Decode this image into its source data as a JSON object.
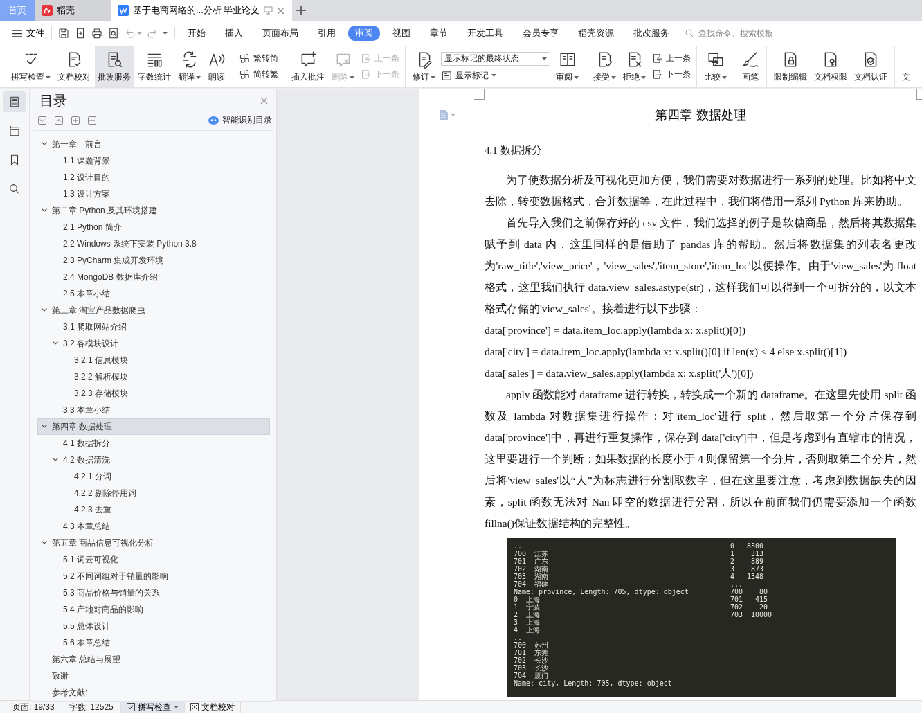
{
  "title_tabs": [
    {
      "kind": "home",
      "label": "首页",
      "selected": false
    },
    {
      "kind": "docer",
      "label": "稻壳",
      "selected": false
    },
    {
      "kind": "document",
      "label": "基于电商网络的...分析 毕业论文",
      "selected": true
    }
  ],
  "menu": {
    "file": "文件",
    "tabs": [
      {
        "label": "开始",
        "selected": false
      },
      {
        "label": "插入",
        "selected": false
      },
      {
        "label": "页面布局",
        "selected": false
      },
      {
        "label": "引用",
        "selected": false
      },
      {
        "label": "审阅",
        "selected": true
      },
      {
        "label": "视图",
        "selected": false
      },
      {
        "label": "章节",
        "selected": false
      },
      {
        "label": "开发工具",
        "selected": false
      },
      {
        "label": "会员专享",
        "selected": false
      },
      {
        "label": "稻壳资源",
        "selected": false
      },
      {
        "label": "批改服务",
        "selected": false
      }
    ],
    "search": {
      "placeholder": "查找命令、搜索模板"
    }
  },
  "ribbon": {
    "groups": [
      {
        "items": [
          {
            "kind": "large",
            "label": "拼写检查",
            "caret": true,
            "selected": false
          },
          {
            "kind": "large",
            "label": "文档校对",
            "selected": false
          },
          {
            "kind": "large",
            "label": "批改服务",
            "selected": true
          },
          {
            "kind": "large",
            "label": "字数统计",
            "selected": false
          },
          {
            "kind": "large",
            "label": "翻译",
            "caret": true,
            "selected": false
          },
          {
            "kind": "large",
            "label": "朗读",
            "selected": false
          }
        ]
      },
      {
        "items": [
          {
            "kind": "stack",
            "items": [
              {
                "kind": "small",
                "label": "繁转简",
                "disabled": false
              },
              {
                "kind": "small",
                "label": "简转繁",
                "disabled": false
              }
            ]
          }
        ]
      },
      {
        "items": [
          {
            "kind": "large",
            "label": "插入批注",
            "selected": false
          },
          {
            "kind": "large",
            "label": "删除",
            "caret": true,
            "disabled": true,
            "selected": false
          },
          {
            "kind": "stack",
            "items": [
              {
                "kind": "small",
                "label": "上一条",
                "disabled": true
              },
              {
                "kind": "small",
                "label": "下一条",
                "disabled": true
              }
            ]
          }
        ]
      },
      {
        "items": [
          {
            "kind": "large",
            "label": "修订",
            "caret": true,
            "selected": false
          },
          {
            "kind": "stack",
            "items": [
              {
                "kind": "select",
                "value": "显示标记的最终状态"
              },
              {
                "kind": "small",
                "label": "显示标记",
                "caret": true,
                "disabled": false
              }
            ]
          },
          {
            "kind": "large",
            "label": "审阅",
            "caret": true,
            "selected": false
          }
        ]
      },
      {
        "items": [
          {
            "kind": "large",
            "label": "接受",
            "caret": true,
            "selected": false
          },
          {
            "kind": "large",
            "label": "拒绝",
            "caret": true,
            "selected": false
          },
          {
            "kind": "stack",
            "items": [
              {
                "kind": "small",
                "label": "上一条",
                "disabled": false
              },
              {
                "kind": "small",
                "label": "下一条",
                "disabled": false
              }
            ]
          }
        ]
      },
      {
        "items": [
          {
            "kind": "large",
            "label": "比较",
            "caret": true,
            "selected": false
          }
        ]
      },
      {
        "items": [
          {
            "kind": "large",
            "label": "画笔",
            "selected": false
          }
        ]
      },
      {
        "items": [
          {
            "kind": "large",
            "label": "限制编辑",
            "selected": false
          },
          {
            "kind": "large",
            "label": "文档权限",
            "selected": false
          },
          {
            "kind": "large",
            "label": "文档认证",
            "selected": false
          }
        ]
      },
      {
        "items": [
          {
            "kind": "large",
            "label": "文",
            "selected": false
          }
        ]
      }
    ]
  },
  "sidebar": {
    "tools": [
      {
        "selected": true
      },
      {
        "selected": false
      },
      {
        "selected": false
      },
      {
        "selected": false
      }
    ]
  },
  "toc": {
    "title": "目录",
    "smart_link": "智能识别目录",
    "items": [
      {
        "label": "第一章　前言",
        "expanded": true,
        "selected": false,
        "children": [
          {
            "label": "1.1 课题背景",
            "selected": false
          },
          {
            "label": "1.2 设计目的",
            "selected": false
          },
          {
            "label": "1.3 设计方案",
            "selected": false
          }
        ]
      },
      {
        "label": "第二章  Python 及其环境搭建",
        "expanded": true,
        "selected": false,
        "children": [
          {
            "label": "2.1 Python 简介",
            "selected": false
          },
          {
            "label": "2.2 Windows 系统下安装 Python 3.8",
            "selected": false
          },
          {
            "label": "2.3 PyCharm 集成开发环境",
            "selected": false
          },
          {
            "label": "2.4 MongoDB 数据库介绍",
            "selected": false
          },
          {
            "label": "2.5  本章小结",
            "selected": false
          }
        ]
      },
      {
        "label": "第三章  淘宝产品数据爬虫",
        "expanded": true,
        "selected": false,
        "children": [
          {
            "label": "3.1  爬取网站介绍",
            "selected": false
          },
          {
            "label": "3.2  各模块设计",
            "expanded": true,
            "selected": false,
            "children": [
              {
                "label": "3.2.1  信息模块",
                "selected": false
              },
              {
                "label": "3.2.2 解析模块",
                "selected": false
              },
              {
                "label": "3.2.3  存储模块",
                "selected": false
              }
            ]
          },
          {
            "label": "3.3  本章小结",
            "selected": false
          }
        ]
      },
      {
        "label": "第四章  数据处理",
        "expanded": true,
        "selected": true,
        "children": [
          {
            "label": "4.1  数据拆分",
            "selected": false
          },
          {
            "label": "4.2  数据清洗",
            "expanded": true,
            "selected": false,
            "children": [
              {
                "label": "4.2.1  分词",
                "selected": false
              },
              {
                "label": "4.2.2 剔除停用词",
                "selected": false
              },
              {
                "label": "4.2.3  去重",
                "selected": false
              }
            ]
          },
          {
            "label": "4.3  本章总结",
            "selected": false
          }
        ]
      },
      {
        "label": "第五章  商品信息可视化分析",
        "expanded": true,
        "selected": false,
        "children": [
          {
            "label": "5.1  词云可视化",
            "selected": false
          },
          {
            "label": "5.2  不同词组对于销量的影响",
            "selected": false
          },
          {
            "label": "5.3  商品价格与销量的关系",
            "selected": false
          },
          {
            "label": "5.4 产地对商品的影响",
            "selected": false
          },
          {
            "label": "5.5 总体设计",
            "selected": false
          },
          {
            "label": "5.6  本章总结",
            "selected": false
          }
        ]
      },
      {
        "label": "第六章  总结与展望",
        "selected": false
      },
      {
        "label": "致谢",
        "selected": false
      },
      {
        "label": "参考文献:",
        "selected": false
      }
    ]
  },
  "document": {
    "heading": "第四章  数据处理",
    "section": "4.1  数据拆分",
    "blocks": [
      {
        "kind": "para",
        "text": "为了使数据分析及可视化更加方便，我们需要对数据进行一系列的处理。比如将中文去除，转变数据格式，合并数据等，在此过程中，我们将借用一系列 Python 库来协助。"
      },
      {
        "kind": "para",
        "text": "首先导入我们之前保存好的 csv 文件，我们选择的例子是软糖商品，然后将其数据集赋予到 data 内，这里同样的是借助了 pandas 库的帮助。然后将数据集的列表名更改为'raw_title','view_price'，'view_sales','item_store','item_loc'以便操作。由于'view_sales'为 float 格式，这里我们执行 data.view_sales.astype(str)，这样我们可以得到一个可拆分的，以文本格式存储的'view_sales'。接着进行以下步骤："
      },
      {
        "kind": "code",
        "text": "data['province'] = data.item_loc.apply(lambda x: x.split()[0])"
      },
      {
        "kind": "code",
        "text": "data['city'] = data.item_loc.apply(lambda x: x.split()[0] if len(x) < 4 else x.split()[1])"
      },
      {
        "kind": "code",
        "text": "data['sales'] = data.view_sales.apply(lambda x: x.split('人')[0])"
      },
      {
        "kind": "para",
        "text": "apply 函数能对 dataframe 进行转换，转换成一个新的 dataframe。在这里先使用 split 函数及 lambda 对数据集进行操作：对'item_loc'进行 split，然后取第一个分片保存到 data['province']中，再进行重复操作，保存到 data['city']中，但是考虑到有直辖市的情况，这里要进行一个判断：如果数据的长度小于 4 则保留第一个分片，否则取第二个分片，然后将'view_sales'以“人”为标志进行分割取数字，但在这里要注意，考虑到数据缺失的因素，split 函数无法对 Nan 即空的数据进行分割，所以在前面我们仍需要添加一个函数 fillna()保证数据结构的完整性。"
      },
      {
        "kind": "console",
        "groups": [
          {
            "lines": [
              "..",
              "700  江苏",
              "701  广东",
              "702  湖南",
              "703  湖南",
              "704  福建",
              "Name: province, Length: 705, dtype: object"
            ]
          },
          {
            "lines": [
              "0  上海",
              "1  宁波",
              "2  上海",
              "3  上海",
              "4  上海",
              "..",
              "700  苏州",
              "701  东莞",
              "702  长沙",
              "703  长沙",
              "704  厦门",
              "Name: city, Length: 705, dtype: object"
            ]
          },
          {
            "lines": [
              "0   8500",
              "1    313",
              "2    889",
              "3    873",
              "4   1348",
              "...",
              "700    80",
              "701   415",
              "702    20",
              "703  10000"
            ]
          }
        ]
      }
    ]
  },
  "status_bar": {
    "page": "页面: 19/33",
    "words": "字数: 12525",
    "spell": {
      "label": "拼写检查",
      "checked": true
    },
    "proof": {
      "label": "文档校对"
    }
  }
}
